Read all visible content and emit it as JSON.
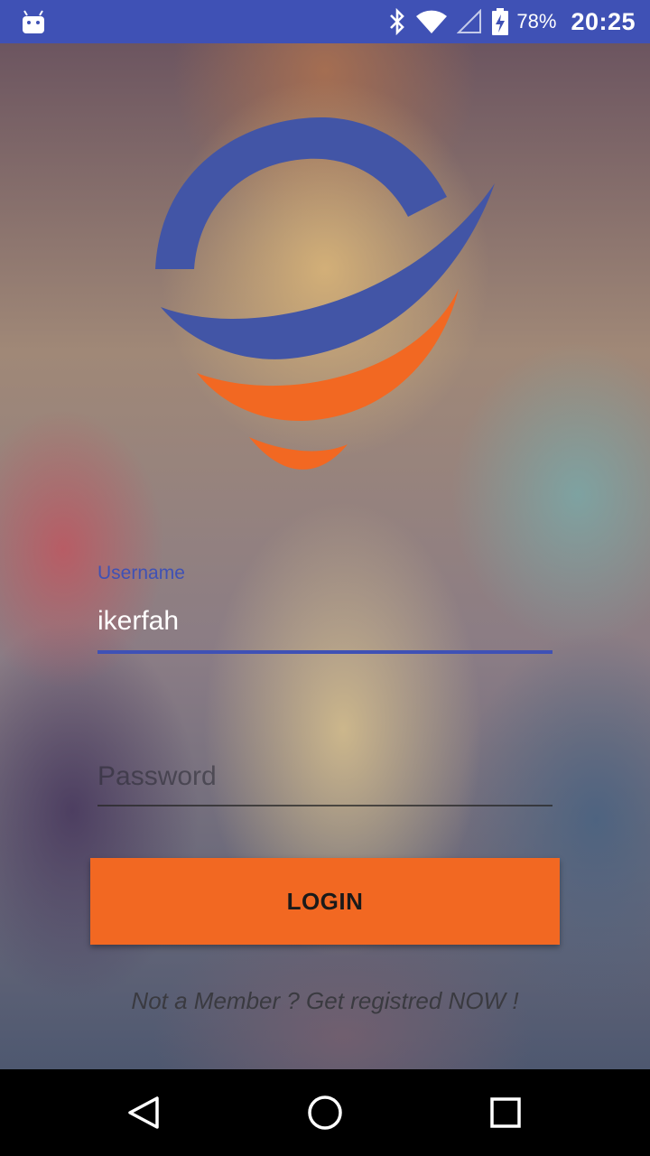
{
  "status_bar": {
    "battery_percent": "78%",
    "time": "20:25",
    "icons": [
      "android-debug-icon",
      "bluetooth-icon",
      "wifi-icon",
      "cell-signal-icon",
      "battery-charging-icon"
    ]
  },
  "login_form": {
    "username": {
      "label": "Username",
      "value": "ikerfah"
    },
    "password": {
      "placeholder": "Password",
      "value": ""
    },
    "login_button_label": "LOGIN",
    "register_link": "Not a Member ? Get registred NOW !"
  },
  "logo": {
    "icon": "globe-swoosh-logo",
    "colors": {
      "blue": "#4255a6",
      "orange": "#f26822"
    }
  },
  "navigation_bar": {
    "buttons": [
      "back-icon",
      "home-icon",
      "recent-apps-icon"
    ]
  },
  "colors": {
    "status_bar": "#3f51b5",
    "accent": "#3f51b5",
    "login_button": "#f26822",
    "nav_bar": "#000000"
  }
}
